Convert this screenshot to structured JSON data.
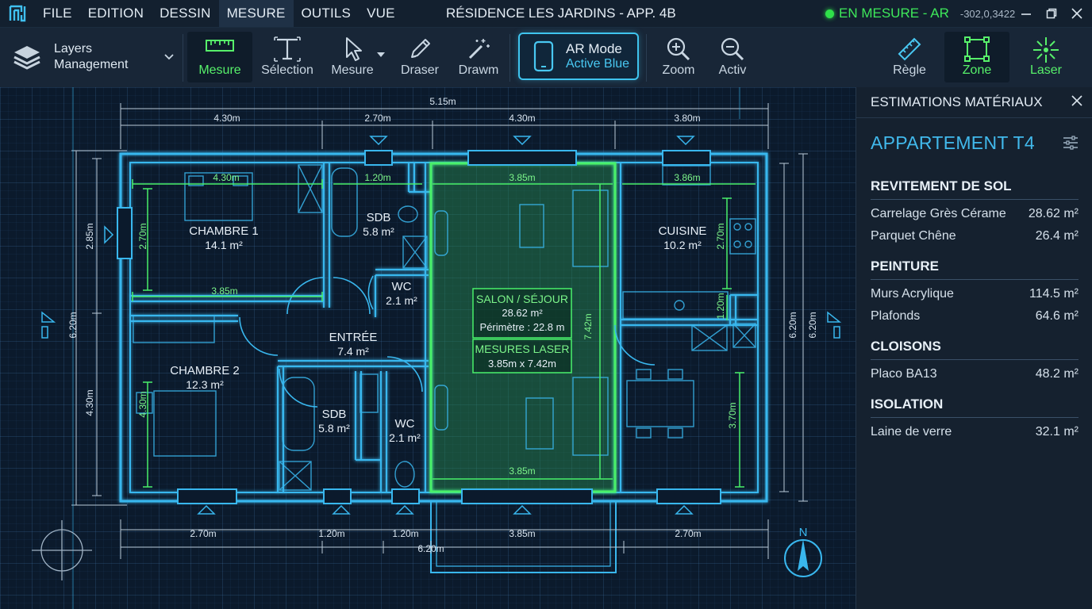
{
  "menu": {
    "items": [
      "FILE",
      "EDITION",
      "DESSIN",
      "MESURE",
      "OUTILS",
      "VUE"
    ],
    "active_index": 3
  },
  "window": {
    "title": "RÉSIDENCE LES JARDINS - APP. 4B"
  },
  "status": {
    "label": "EN MESURE - AR",
    "coordinates": "-302,0,3422",
    "color": "#2fe04a"
  },
  "toolbar": {
    "layers_label": "Layers Management",
    "tools": {
      "mesure_active": "Mesure",
      "selection": "Sélection",
      "mesure": "Mesure",
      "draser": "Draser",
      "drawm": "Drawm",
      "zoom": "Zoom",
      "activ": "Activ",
      "regle": "Règle",
      "zone": "Zone",
      "laser": "Laser"
    },
    "ar_mode": {
      "line1": "AR Mode",
      "line2": "Active Blue"
    }
  },
  "plan": {
    "rooms": {
      "chambre1": {
        "name": "CHAMBRE 1",
        "area": "14.1 m²"
      },
      "chambre2": {
        "name": "CHAMBRE 2",
        "area": "12.3 m²"
      },
      "sdb1": {
        "name": "SDB",
        "area": "5.8 m²"
      },
      "sdb2": {
        "name": "SDB",
        "area": "5.8 m²"
      },
      "wc1": {
        "name": "WC",
        "area": "2.1 m²"
      },
      "wc2": {
        "name": "WC",
        "area": "2.1 m²"
      },
      "entree": {
        "name": "ENTRÉE",
        "area": "7.4 m²"
      },
      "cuisine": {
        "name": "CUISINE",
        "area": "10.2 m²"
      },
      "salon": {
        "name": "SALON / SÉJOUR",
        "area": "28.62 m²",
        "perimeter": "Périmètre : 22.8 m"
      },
      "laser": {
        "title": "MESURES LASER",
        "value": "3.85m x 7.42m"
      }
    },
    "dims_top": {
      "total": "5.15m",
      "d1": "4.30m",
      "d2": "2.70m",
      "d3": "4.30m",
      "d4": "3.80m"
    },
    "dims_bottom": {
      "total": "6.20m",
      "d1": "2.70m",
      "d2": "1.20m",
      "d3": "1.20m",
      "d4": "3.85m",
      "d5": "2.70m"
    },
    "dims_left": {
      "total": "6.20m",
      "upper": "2.85m",
      "lower": "4.30m"
    },
    "dims_right": {
      "outer": "6.20m",
      "inner": "6.20m"
    },
    "inner_dims": {
      "ch1_top": "4.30m",
      "ch1_mid": "3.85m",
      "ch1_side": "2.70m",
      "sdb_top": "1.20m",
      "salon_top": "3.85m",
      "salon_bottom": "3.85m",
      "salon_side": "7.42m",
      "cuisine_top": "3.86m",
      "cuisine_side": "2.70m",
      "cuisine_small": "1.20m",
      "cuisine_lower": "3.70m",
      "ch2_side": "4.30m"
    },
    "compass_label": "N",
    "accent_blue": "#39b7ee",
    "accent_green": "#49f06a"
  },
  "panel": {
    "title": "ESTIMATIONS MATÉRIAUX",
    "project": "APPARTEMENT T4",
    "sections": [
      {
        "title": "REVITEMENT DE SOL",
        "rows": [
          {
            "label": "Carrelage Grès Cérame",
            "value": "28.62 m²"
          },
          {
            "label": "Parquet Chêne",
            "value": "26.4 m²"
          }
        ]
      },
      {
        "title": "PEINTURE",
        "rows": [
          {
            "label": "Murs Acrylique",
            "value": "114.5 m²"
          },
          {
            "label": "Plafonds",
            "value": "64.6 m²"
          }
        ]
      },
      {
        "title": "CLOISONS",
        "rows": [
          {
            "label": "Placo BA13",
            "value": "48.2 m²"
          }
        ]
      },
      {
        "title": "ISOLATION",
        "rows": [
          {
            "label": "Laine de verre",
            "value": "32.1 m²"
          }
        ]
      }
    ]
  }
}
